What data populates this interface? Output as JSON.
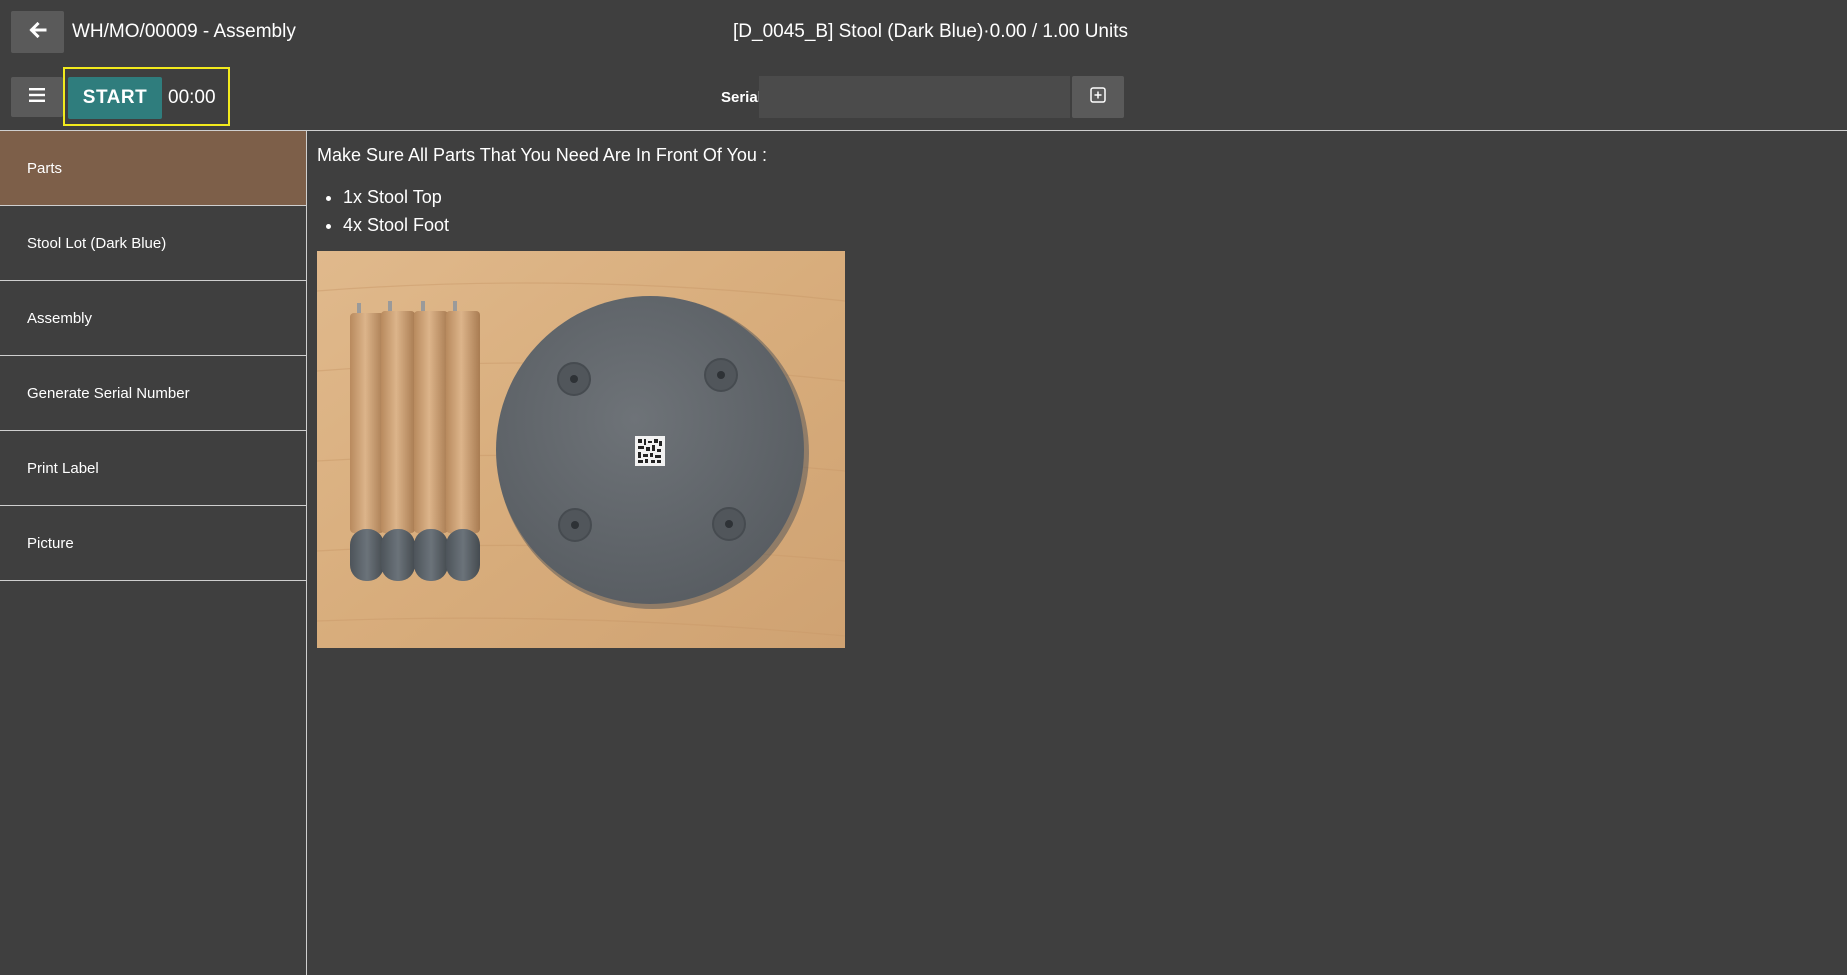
{
  "header": {
    "work_order": "WH/MO/00009 - Assembly",
    "product_quantity": "[D_0045_B] Stool (Dark Blue)·0.00 / 1.00 Units",
    "start_label": "START",
    "timer": "00:00",
    "serial_label": "Serial",
    "serial_value": "",
    "icons": {
      "back": "arrow-left-icon",
      "menu": "hamburger-menu-icon",
      "add": "plus-square-icon"
    }
  },
  "sidebar": {
    "steps": [
      {
        "label": "Parts",
        "active": true
      },
      {
        "label": "Stool Lot (Dark Blue)",
        "active": false
      },
      {
        "label": "Assembly",
        "active": false
      },
      {
        "label": "Generate Serial Number",
        "active": false
      },
      {
        "label": "Print Label",
        "active": false
      },
      {
        "label": "Picture",
        "active": false
      }
    ]
  },
  "main": {
    "heading": "Make Sure All Parts That You Need Are In Front Of You :",
    "parts": [
      "1x Stool Top",
      "4x Stool Foot"
    ]
  },
  "colors": {
    "background": "#3f3f3f",
    "start_button": "#2f7d7d",
    "active_step": "#7d5f49",
    "highlight_border": "#f2ea1d",
    "button_gray": "#5a5a5a"
  }
}
